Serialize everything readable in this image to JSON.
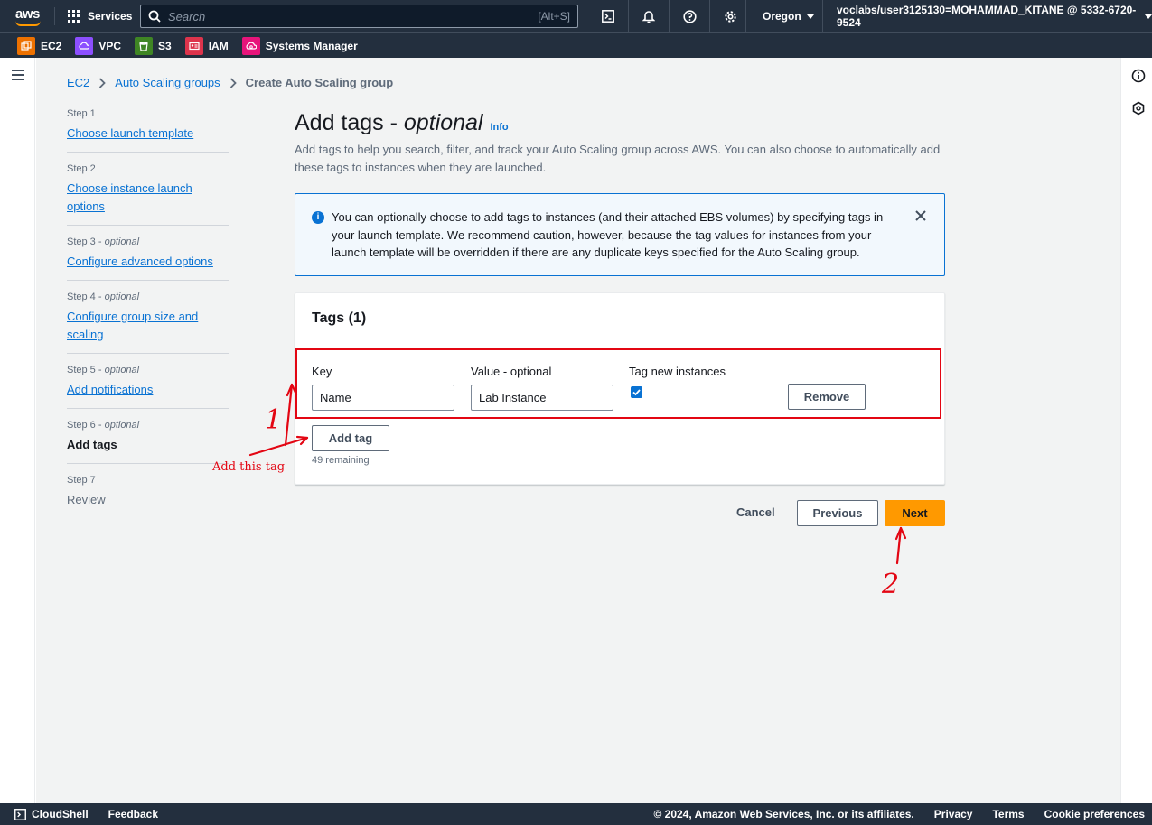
{
  "topnav": {
    "logo": "aws",
    "services_label": "Services",
    "search_placeholder": "Search",
    "search_shortcut": "[Alt+S]",
    "region": "Oregon",
    "account": "voclabs/user3125130=MOHAMMAD_KITANE @ 5332-6720-9524"
  },
  "favorites": [
    {
      "label": "EC2",
      "color": "#ed7100",
      "icon": "ec2-icon"
    },
    {
      "label": "VPC",
      "color": "#8c4fff",
      "icon": "vpc-icon"
    },
    {
      "label": "S3",
      "color": "#3f8624",
      "icon": "s3-icon"
    },
    {
      "label": "IAM",
      "color": "#dd344c",
      "icon": "iam-icon"
    },
    {
      "label": "Systems Manager",
      "color": "#e7157b",
      "icon": "systems-manager-icon"
    }
  ],
  "breadcrumb": {
    "items": [
      "EC2",
      "Auto Scaling groups"
    ],
    "current": "Create Auto Scaling group"
  },
  "steps": [
    {
      "num": "Step 1",
      "optional": "",
      "label": "Choose launch template",
      "state": "link"
    },
    {
      "num": "Step 2",
      "optional": "",
      "label": "Choose instance launch options",
      "state": "link"
    },
    {
      "num": "Step 3 - ",
      "optional": "optional",
      "label": "Configure advanced options",
      "state": "link"
    },
    {
      "num": "Step 4 - ",
      "optional": "optional",
      "label": "Configure group size and scaling",
      "state": "link"
    },
    {
      "num": "Step 5 - ",
      "optional": "optional",
      "label": "Add notifications",
      "state": "link"
    },
    {
      "num": "Step 6 - ",
      "optional": "optional",
      "label": "Add tags",
      "state": "active"
    },
    {
      "num": "Step 7",
      "optional": "",
      "label": "Review",
      "state": "disabled"
    }
  ],
  "page": {
    "title": "Add tags - ",
    "title_optional": "optional",
    "info": "Info",
    "description": "Add tags to help you search, filter, and track your Auto Scaling group across AWS. You can also choose to automatically add these tags to instances when they are launched."
  },
  "alert": {
    "text": "You can optionally choose to add tags to instances (and their attached EBS volumes) by specifying tags in your launch template. We recommend caution, however, because the tag values for instances from your launch template will be overridden if there are any duplicate keys specified for the Auto Scaling group."
  },
  "tags_panel": {
    "title": "Tags (1)",
    "key_label": "Key",
    "value_label": "Value - optional",
    "tag_new_label": "Tag new instances",
    "key_value": "Name",
    "value_value": "Lab Instance",
    "tag_new_checked": true,
    "remove_label": "Remove",
    "add_tag_label": "Add tag",
    "remaining": "49 remaining"
  },
  "actions": {
    "cancel": "Cancel",
    "previous": "Previous",
    "next": "Next"
  },
  "annotations": {
    "label_1": "1",
    "label_2": "2",
    "note": "Add this tag"
  },
  "footer": {
    "cloudshell": "CloudShell",
    "feedback": "Feedback",
    "copyright": "© 2024, Amazon Web Services, Inc. or its affiliates.",
    "privacy": "Privacy",
    "terms": "Terms",
    "cookies": "Cookie preferences"
  },
  "colors": {
    "nav_bg": "#232f3e",
    "link": "#0972d3",
    "primary_button": "#ff9900",
    "annotation": "#e30613"
  }
}
